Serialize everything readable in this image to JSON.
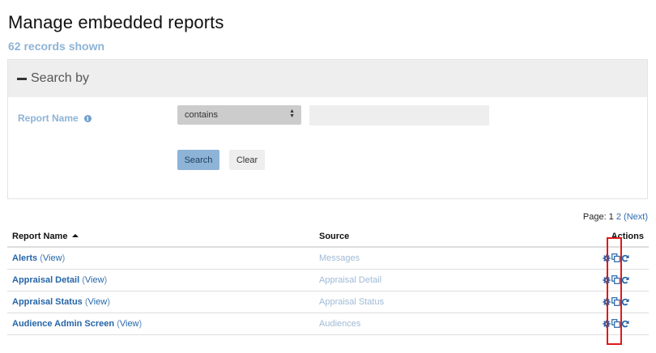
{
  "header": {
    "title": "Manage embedded reports",
    "records_shown": "62 records shown"
  },
  "search": {
    "header_label": "Search by",
    "field_label": "Report Name",
    "operator_value": "contains",
    "input_value": "",
    "search_button": "Search",
    "clear_button": "Clear"
  },
  "pager": {
    "prefix": "Page: 1",
    "page_2": "2",
    "next": "(Next)"
  },
  "table": {
    "columns": {
      "name": "Report Name",
      "source": "Source",
      "actions": "Actions"
    },
    "rows": [
      {
        "name": "Alerts",
        "view": "View",
        "source": "Messages"
      },
      {
        "name": "Appraisal Detail",
        "view": "View",
        "source": "Appraisal Detail"
      },
      {
        "name": "Appraisal Status",
        "view": "View",
        "source": "Appraisal Status"
      },
      {
        "name": "Audience Admin Screen",
        "view": "View",
        "source": "Audiences"
      }
    ]
  },
  "icons": {
    "settings": "gear-icon",
    "clone": "copy-icon",
    "refresh": "refresh-icon",
    "collapse": "minus-icon",
    "info": "info-icon",
    "sort": "sort-ascending-icon"
  },
  "colors": {
    "accent": "#8db3d6",
    "link": "#2565a8",
    "highlight": "#e0191b"
  }
}
